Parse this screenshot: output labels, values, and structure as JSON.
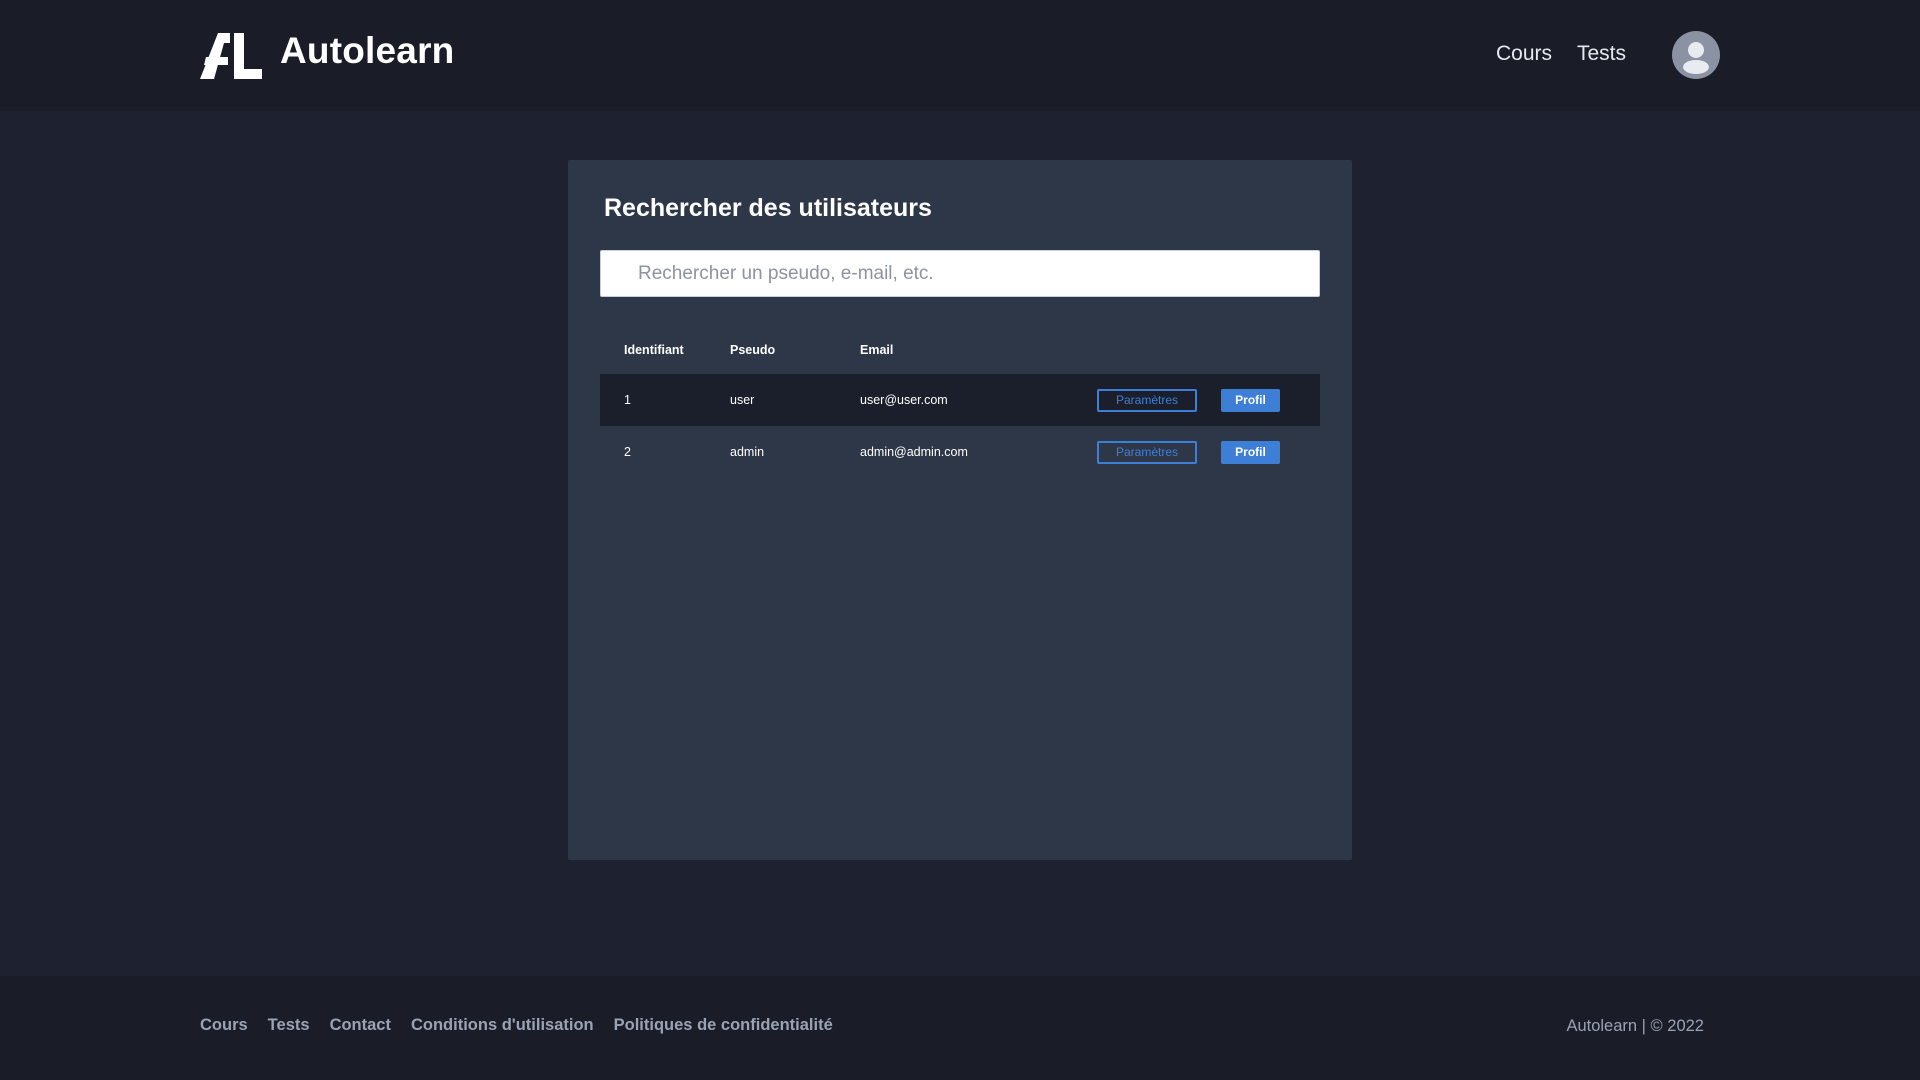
{
  "header": {
    "brand": "Autolearn",
    "nav": [
      "Cours",
      "Tests"
    ]
  },
  "card": {
    "title": "Rechercher des utilisateurs",
    "search_placeholder": "Rechercher un pseudo, e-mail, etc."
  },
  "table": {
    "columns": [
      "Identifiant",
      "Pseudo",
      "Email"
    ],
    "rows": [
      {
        "id": "1",
        "pseudo": "user",
        "email": "user@user.com"
      },
      {
        "id": "2",
        "pseudo": "admin",
        "email": "admin@admin.com"
      }
    ],
    "settings_label": "Paramètres",
    "profile_label": "Profil"
  },
  "footer": {
    "links": [
      "Cours",
      "Tests",
      "Contact",
      "Conditions d'utilisation",
      "Politiques de confidentialité"
    ],
    "copyright": "Autolearn | © 2022"
  },
  "colors": {
    "background": "#1e2230",
    "header_bg": "#1a1d28",
    "card_bg": "#2e3748",
    "accent": "#3d7fd6"
  },
  "icons": {
    "logo": "autolearn-logo-icon",
    "avatar": "user-avatar-icon"
  }
}
